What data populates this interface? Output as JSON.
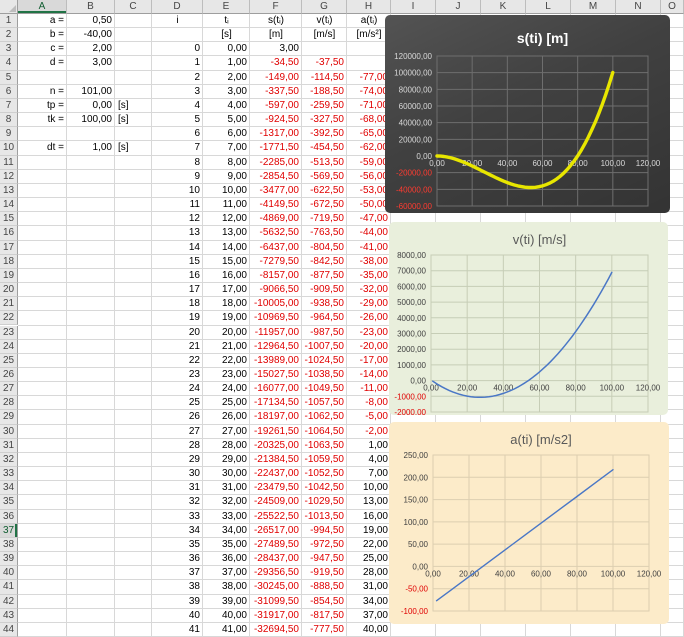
{
  "sheet": {
    "columns": [
      "A",
      "B",
      "C",
      "D",
      "E",
      "F",
      "G",
      "H",
      "I",
      "J",
      "K",
      "L",
      "M",
      "N",
      "O"
    ],
    "row_count": 44,
    "selected_row": 37,
    "selected_col": "A",
    "params": [
      {
        "row": 1,
        "label": "a =",
        "value": "0,50",
        "unit": ""
      },
      {
        "row": 2,
        "label": "b =",
        "value": "-40,00",
        "unit": ""
      },
      {
        "row": 3,
        "label": "c =",
        "value": "2,00",
        "unit": ""
      },
      {
        "row": 4,
        "label": "d =",
        "value": "3,00",
        "unit": ""
      },
      {
        "row": 6,
        "label": "n =",
        "value": "101,00",
        "unit": ""
      },
      {
        "row": 7,
        "label": "tp =",
        "value": "0,00",
        "unit": "[s]"
      },
      {
        "row": 8,
        "label": "tk =",
        "value": "100,00",
        "unit": "[s]"
      },
      {
        "row": 10,
        "label": "dt =",
        "value": "1,00",
        "unit": "[s]"
      }
    ],
    "table": {
      "headers": {
        "i": "i",
        "t": "tᵢ",
        "s": "s(tᵢ)",
        "v": "v(tᵢ)",
        "a": "a(tᵢ)"
      },
      "units": {
        "t": "[s]",
        "s": "[m]",
        "v": "[m/s]",
        "a": "[m/s²]"
      },
      "rows": [
        [
          "0",
          "0,00",
          "3,00",
          "",
          ""
        ],
        [
          "1",
          "1,00",
          "-34,50",
          "-37,50",
          ""
        ],
        [
          "2",
          "2,00",
          "-149,00",
          "-114,50",
          "-77,00"
        ],
        [
          "3",
          "3,00",
          "-337,50",
          "-188,50",
          "-74,00"
        ],
        [
          "4",
          "4,00",
          "-597,00",
          "-259,50",
          "-71,00"
        ],
        [
          "5",
          "5,00",
          "-924,50",
          "-327,50",
          "-68,00"
        ],
        [
          "6",
          "6,00",
          "-1317,00",
          "-392,50",
          "-65,00"
        ],
        [
          "7",
          "7,00",
          "-1771,50",
          "-454,50",
          "-62,00"
        ],
        [
          "8",
          "8,00",
          "-2285,00",
          "-513,50",
          "-59,00"
        ],
        [
          "9",
          "9,00",
          "-2854,50",
          "-569,50",
          "-56,00"
        ],
        [
          "10",
          "10,00",
          "-3477,00",
          "-622,50",
          "-53,00"
        ],
        [
          "11",
          "11,00",
          "-4149,50",
          "-672,50",
          "-50,00"
        ],
        [
          "12",
          "12,00",
          "-4869,00",
          "-719,50",
          "-47,00"
        ],
        [
          "13",
          "13,00",
          "-5632,50",
          "-763,50",
          "-44,00"
        ],
        [
          "14",
          "14,00",
          "-6437,00",
          "-804,50",
          "-41,00"
        ],
        [
          "15",
          "15,00",
          "-7279,50",
          "-842,50",
          "-38,00"
        ],
        [
          "16",
          "16,00",
          "-8157,00",
          "-877,50",
          "-35,00"
        ],
        [
          "17",
          "17,00",
          "-9066,50",
          "-909,50",
          "-32,00"
        ],
        [
          "18",
          "18,00",
          "-10005,00",
          "-938,50",
          "-29,00"
        ],
        [
          "19",
          "19,00",
          "-10969,50",
          "-964,50",
          "-26,00"
        ],
        [
          "20",
          "20,00",
          "-11957,00",
          "-987,50",
          "-23,00"
        ],
        [
          "21",
          "21,00",
          "-12964,50",
          "-1007,50",
          "-20,00"
        ],
        [
          "22",
          "22,00",
          "-13989,00",
          "-1024,50",
          "-17,00"
        ],
        [
          "23",
          "23,00",
          "-15027,50",
          "-1038,50",
          "-14,00"
        ],
        [
          "24",
          "24,00",
          "-16077,00",
          "-1049,50",
          "-11,00"
        ],
        [
          "25",
          "25,00",
          "-17134,50",
          "-1057,50",
          "-8,00"
        ],
        [
          "26",
          "26,00",
          "-18197,00",
          "-1062,50",
          "-5,00"
        ],
        [
          "27",
          "27,00",
          "-19261,50",
          "-1064,50",
          "-2,00"
        ],
        [
          "28",
          "28,00",
          "-20325,00",
          "-1063,50",
          "1,00"
        ],
        [
          "29",
          "29,00",
          "-21384,50",
          "-1059,50",
          "4,00"
        ],
        [
          "30",
          "30,00",
          "-22437,00",
          "-1052,50",
          "7,00"
        ],
        [
          "31",
          "31,00",
          "-23479,50",
          "-1042,50",
          "10,00"
        ],
        [
          "32",
          "32,00",
          "-24509,00",
          "-1029,50",
          "13,00"
        ],
        [
          "33",
          "33,00",
          "-25522,50",
          "-1013,50",
          "16,00"
        ],
        [
          "34",
          "34,00",
          "-26517,00",
          "-994,50",
          "19,00"
        ],
        [
          "35",
          "35,00",
          "-27489,50",
          "-972,50",
          "22,00"
        ],
        [
          "36",
          "36,00",
          "-28437,00",
          "-947,50",
          "25,00"
        ],
        [
          "37",
          "37,00",
          "-29356,50",
          "-919,50",
          "28,00"
        ],
        [
          "38",
          "38,00",
          "-30245,00",
          "-888,50",
          "31,00"
        ],
        [
          "39",
          "39,00",
          "-31099,50",
          "-854,50",
          "34,00"
        ],
        [
          "40",
          "40,00",
          "-31917,00",
          "-817,50",
          "37,00"
        ],
        [
          "41",
          "41,00",
          "-32694,50",
          "-777,50",
          "40,00"
        ]
      ]
    }
  },
  "chart_data": [
    {
      "type": "line",
      "title": "s(ti) [m]",
      "xlabel": "",
      "ylabel": "",
      "xlim": [
        0,
        120
      ],
      "xstep": 20,
      "ylim": [
        -60000,
        120000
      ],
      "ystep": 20000,
      "grid": true,
      "legend": "none",
      "x": [
        0,
        2,
        4,
        6,
        8,
        10,
        12,
        14,
        16,
        18,
        20,
        22,
        24,
        26,
        28,
        30,
        32,
        34,
        36,
        38,
        40,
        42,
        44,
        46,
        48,
        50,
        52,
        54,
        56,
        58,
        60,
        62,
        64,
        66,
        68,
        70,
        72,
        74,
        76,
        78,
        80,
        82,
        84,
        86,
        88,
        90,
        92,
        94,
        96,
        98,
        100
      ],
      "y": [
        3,
        -149,
        -597,
        -1317,
        -2285,
        -3477,
        -4869,
        -6437,
        -8157,
        -10005,
        -11957,
        -13989,
        -16077,
        -18197,
        -20325,
        -22437,
        -24509,
        -26517,
        -28437,
        -30245,
        -31917,
        -33429,
        -34757,
        -35877,
        -36765,
        -37397,
        -37749,
        -37797,
        -37517,
        -36885,
        -35877,
        -34469,
        -32637,
        -30357,
        -27605,
        -24357,
        -20589,
        -16277,
        -11397,
        -5925,
        163,
        6891,
        14283,
        22363,
        31155,
        40683,
        50971,
        62043,
        73923,
        86635,
        100203
      ],
      "colors": {
        "bg": "#404040",
        "title": "#ffffff",
        "label": "#d9d9d9",
        "neg_label": "#ff3b30",
        "grid": "#6e6e6e",
        "line": "#e8e600"
      },
      "line_width": 3.4,
      "title_bold": true
    },
    {
      "type": "line",
      "title": "v(ti) [m/s]",
      "xlabel": "",
      "ylabel": "",
      "xlim": [
        0,
        120
      ],
      "xstep": 20,
      "ylim": [
        -2000,
        8000
      ],
      "ystep": 1000,
      "grid": true,
      "legend": "none",
      "x": [
        1,
        2,
        4,
        6,
        8,
        10,
        12,
        14,
        16,
        18,
        20,
        22,
        24,
        26,
        28,
        30,
        32,
        34,
        36,
        38,
        40,
        42,
        44,
        46,
        48,
        50,
        52,
        54,
        56,
        58,
        60,
        62,
        64,
        66,
        68,
        70,
        72,
        74,
        76,
        78,
        80,
        82,
        84,
        86,
        88,
        90,
        92,
        94,
        96,
        98,
        100
      ],
      "y": [
        -37.5,
        -114.5,
        -259.5,
        -392.5,
        -513.5,
        -622.5,
        -719.5,
        -804.5,
        -877.5,
        -938.5,
        -987.5,
        -1024.5,
        -1049.5,
        -1062.5,
        -1063.5,
        -1052.5,
        -1029.5,
        -994.5,
        -947.5,
        -888.5,
        -817.5,
        -734.5,
        -639.5,
        -532.5,
        -413.5,
        -282.5,
        -139.5,
        15.5,
        182.5,
        361.5,
        552.5,
        755.5,
        970.5,
        1197.5,
        1436.5,
        1687.5,
        1950.5,
        2225.5,
        2512.5,
        2811.5,
        3122.5,
        3445.5,
        3780.5,
        4127.5,
        4486.5,
        4857.5,
        5240.5,
        5635.5,
        6042.5,
        6461.5,
        6892.5
      ],
      "colors": {
        "bg": "#e9efdc",
        "title": "#595959",
        "label": "#404040",
        "neg_label": "#e00000",
        "grid": "#c6cdb6",
        "line": "#4a77c6"
      },
      "line_width": 1.5,
      "title_bold": false
    },
    {
      "type": "line",
      "title": "a(ti) [m/s2]",
      "xlabel": "",
      "ylabel": "",
      "xlim": [
        0,
        120
      ],
      "xstep": 20,
      "ylim": [
        -100,
        250
      ],
      "ystep": 50,
      "grid": true,
      "legend": "none",
      "x": [
        2,
        10,
        20,
        30,
        40,
        50,
        60,
        70,
        80,
        90,
        100
      ],
      "y": [
        -77,
        -53,
        -23,
        7,
        37,
        67,
        97,
        127,
        157,
        187,
        217
      ],
      "colors": {
        "bg": "#fcebc9",
        "title": "#595959",
        "label": "#404040",
        "neg_label": "#e00000",
        "grid": "#dcceb0",
        "line": "#4a77c6"
      },
      "line_width": 1.4,
      "title_bold": false
    }
  ]
}
